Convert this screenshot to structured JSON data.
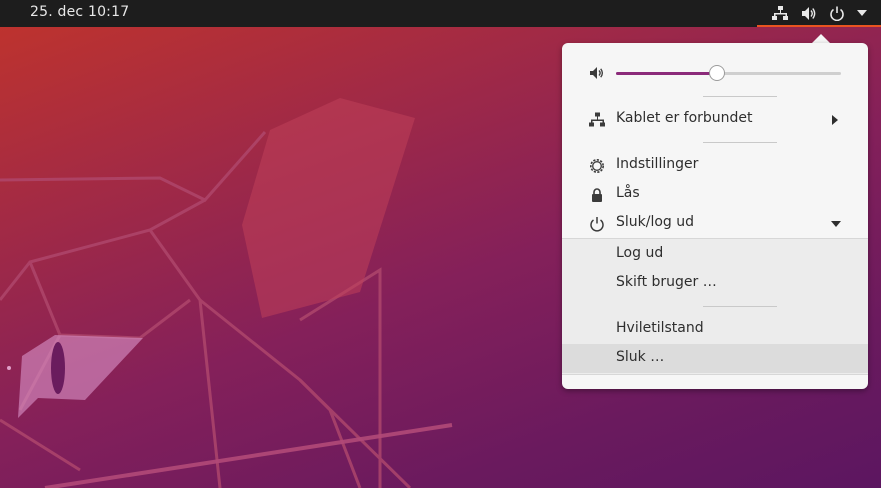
{
  "topbar": {
    "clock": "25. dec  10:17",
    "icons": [
      "network-wired-icon",
      "speaker-icon",
      "power-icon",
      "menu-arrow-icon"
    ],
    "active_indicator_color": "#e95420"
  },
  "system_menu": {
    "volume": {
      "icon": "speaker-icon",
      "level": 0.45
    },
    "network": {
      "label": "Kablet er forbundet",
      "icon": "network-wired-icon"
    },
    "settings": {
      "label": "Indstillinger",
      "icon": "gear-icon"
    },
    "lock": {
      "label": "Lås",
      "icon": "lock-icon"
    },
    "power": {
      "label": "Sluk/log ud",
      "icon": "power-icon"
    },
    "power_submenu": {
      "logout": "Log ud",
      "switch_user": "Skift bruger …",
      "suspend": "Hviletilstand",
      "shutdown": "Sluk …"
    }
  }
}
